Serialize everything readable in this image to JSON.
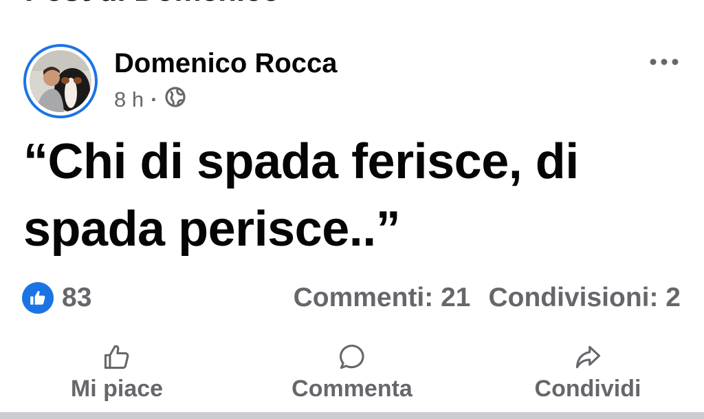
{
  "section": {
    "title": "Post di Domenico"
  },
  "post": {
    "author": "Domenico Rocca",
    "time": "8 h",
    "separator": "·",
    "privacy_icon": "globe-icon",
    "text": "“Chi di spada ferisce, di spada perisce..”",
    "reactions": {
      "icon": "like-icon",
      "count": "83"
    },
    "stats": {
      "comments": "Commenti: 21",
      "shares": "Condivisioni: 2"
    },
    "actions": [
      {
        "label": "Mi piace",
        "icon": "thumbs-up-icon"
      },
      {
        "label": "Commenta",
        "icon": "comment-bubble-icon"
      },
      {
        "label": "Condividi",
        "icon": "share-arrow-icon"
      }
    ]
  },
  "colors": {
    "accent": "#1b74e4",
    "secondary_text": "#65676b",
    "primary_text": "#050505",
    "divider": "#c9ccd1"
  }
}
